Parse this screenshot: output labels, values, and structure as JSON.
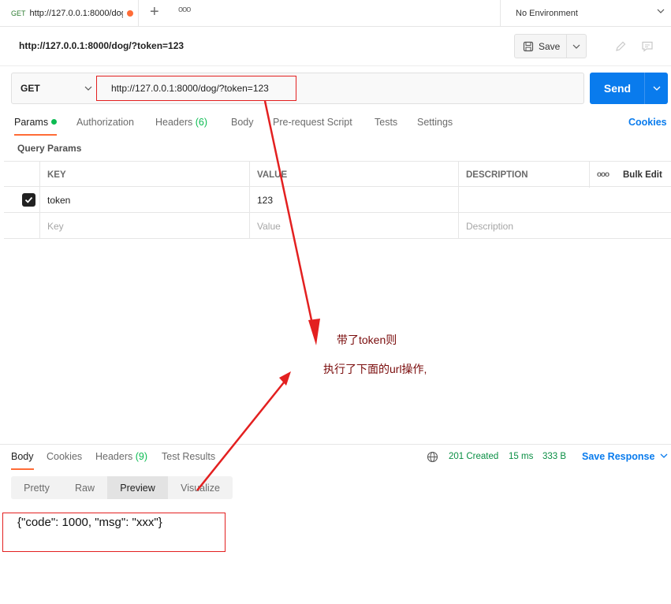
{
  "tab": {
    "method": "GET",
    "title": "http://127.0.0.1:8000/dog/?token=123"
  },
  "environment": {
    "label": "No Environment"
  },
  "request": {
    "name": "http://127.0.0.1:8000/dog/?token=123",
    "save_label": "Save",
    "method": "GET",
    "url": "http://127.0.0.1:8000/dog/?token=123",
    "send_label": "Send"
  },
  "request_tabs": [
    {
      "label": "Params"
    },
    {
      "label": "Authorization"
    },
    {
      "label": "Headers",
      "count": "(6)"
    },
    {
      "label": "Body"
    },
    {
      "label": "Pre-request Script"
    },
    {
      "label": "Tests"
    },
    {
      "label": "Settings"
    }
  ],
  "cookies_label": "Cookies",
  "query_params_label": "Query Params",
  "params_table": {
    "headers": {
      "key": "KEY",
      "value": "VALUE",
      "description": "DESCRIPTION",
      "bulk_edit": "Bulk Edit"
    },
    "rows": [
      {
        "key": "token",
        "value": "123",
        "description": ""
      }
    ],
    "placeholders": {
      "key": "Key",
      "value": "Value",
      "description": "Description"
    }
  },
  "response": {
    "tabs": [
      {
        "label": "Body"
      },
      {
        "label": "Cookies"
      },
      {
        "label": "Headers",
        "count": "(9)"
      },
      {
        "label": "Test Results"
      }
    ],
    "status": "201 Created",
    "time": "15 ms",
    "size": "333 B",
    "save_response_label": "Save Response",
    "view_modes": [
      "Pretty",
      "Raw",
      "Preview",
      "Visualize"
    ],
    "active_view": "Preview",
    "body": "{\"code\": 1000, \"msg\": \"xxx\"}"
  },
  "annotations": {
    "line1": "带了token则",
    "line2": "执行了下面的url操作,"
  },
  "colors": {
    "accent": "#ff6c37",
    "send_button": "#097bed",
    "status_ok": "#0cbb52",
    "annotation": "#e32020"
  }
}
